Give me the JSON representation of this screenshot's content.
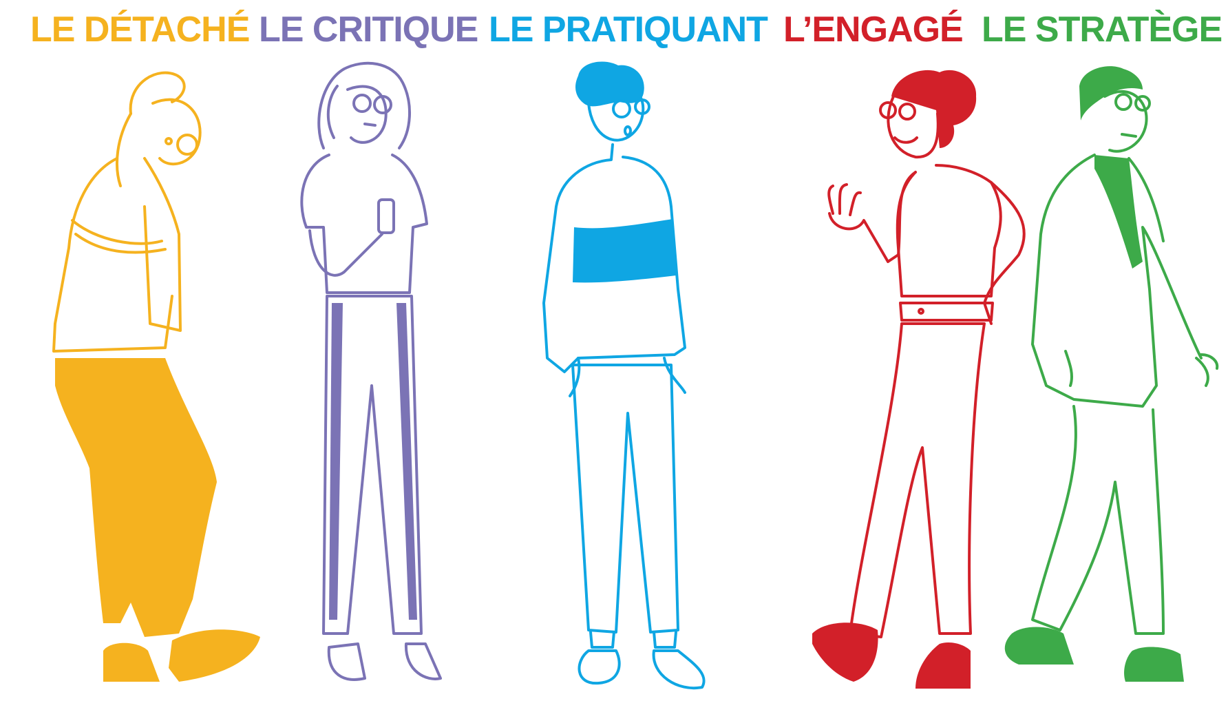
{
  "personas": [
    {
      "label": "LE DÉTACHÉ",
      "color": "#F5B21F"
    },
    {
      "label": "LE CRITIQUE",
      "color": "#7B73B5"
    },
    {
      "label": "LE PRATIQUANT",
      "color": "#0FA6E3"
    },
    {
      "label": "L’ENGAGÉ",
      "color": "#D22029"
    },
    {
      "label": "LE STRATÈGE",
      "color": "#3DAA49"
    }
  ]
}
